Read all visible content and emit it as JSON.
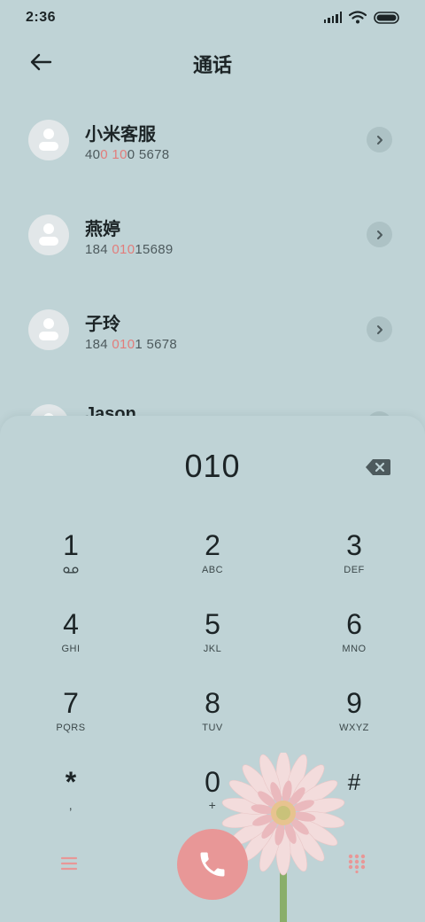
{
  "status_bar": {
    "time": "2:36"
  },
  "header": {
    "title": "通话"
  },
  "contacts": [
    {
      "name": "小米客服",
      "number_parts": [
        "40",
        "0",
        " ",
        "10",
        "0 5678"
      ]
    },
    {
      "name": "燕婷",
      "number_parts": [
        "184 ",
        "010",
        "15689"
      ]
    },
    {
      "name": "子玲",
      "number_parts": [
        "184 ",
        "010",
        "1 5678"
      ]
    },
    {
      "name": "Jason"
    }
  ],
  "dialer": {
    "dialed_number": "010",
    "keys": [
      {
        "digit": "1",
        "letters": ""
      },
      {
        "digit": "2",
        "letters": "ABC"
      },
      {
        "digit": "3",
        "letters": "DEF"
      },
      {
        "digit": "4",
        "letters": "GHI"
      },
      {
        "digit": "5",
        "letters": "JKL"
      },
      {
        "digit": "6",
        "letters": "MNO"
      },
      {
        "digit": "7",
        "letters": "PQRS"
      },
      {
        "digit": "8",
        "letters": "TUV"
      },
      {
        "digit": "9",
        "letters": "WXYZ"
      },
      {
        "digit": "*",
        "letters": ","
      },
      {
        "digit": "0",
        "letters": "+"
      },
      {
        "digit": "#",
        "letters": ""
      }
    ]
  },
  "colors": {
    "background": "#bfd3d6",
    "accent": "#e89797",
    "highlight": "#e27d7b"
  },
  "icons": [
    "signal-icon",
    "wifi-icon",
    "battery-icon",
    "back-arrow-icon",
    "chevron-right-icon",
    "backspace-icon",
    "voicemail-icon",
    "menu-icon",
    "phone-icon",
    "keypad-icon"
  ]
}
